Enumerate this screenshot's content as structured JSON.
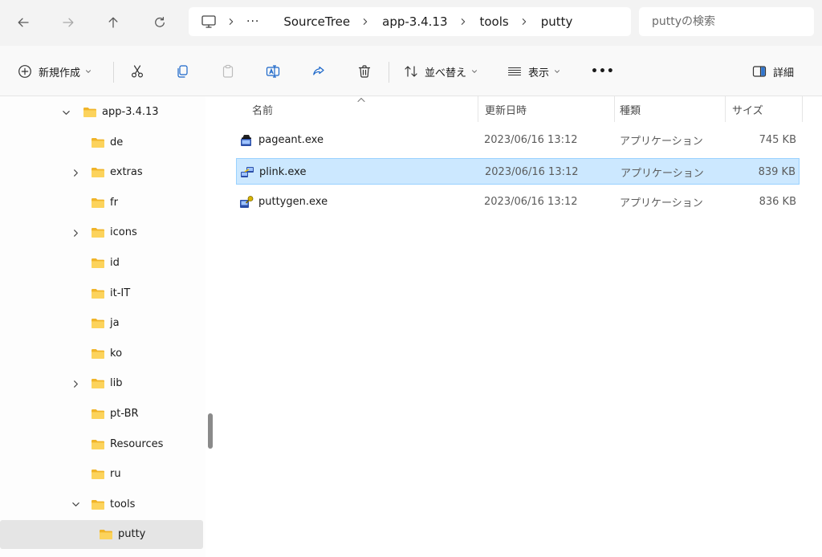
{
  "search": {
    "placeholder": "puttyの検索"
  },
  "breadcrumb": {
    "more": "···",
    "crumbs": [
      "SourceTree",
      "app-3.4.13",
      "tools",
      "putty"
    ]
  },
  "commands": {
    "new": "新規作成",
    "sort": "並べ替え",
    "view": "表示",
    "more": "•••",
    "details": "詳細"
  },
  "tree": {
    "items": [
      {
        "label": "app-3.4.13",
        "expander": "expanded"
      },
      {
        "label": "de",
        "expander": "none"
      },
      {
        "label": "extras",
        "expander": "collapsed"
      },
      {
        "label": "fr",
        "expander": "none"
      },
      {
        "label": "icons",
        "expander": "collapsed"
      },
      {
        "label": "id",
        "expander": "none"
      },
      {
        "label": "it-IT",
        "expander": "none"
      },
      {
        "label": "ja",
        "expander": "none"
      },
      {
        "label": "ko",
        "expander": "none"
      },
      {
        "label": "lib",
        "expander": "collapsed"
      },
      {
        "label": "pt-BR",
        "expander": "none"
      },
      {
        "label": "Resources",
        "expander": "none"
      },
      {
        "label": "ru",
        "expander": "none"
      },
      {
        "label": "tools",
        "expander": "expanded"
      },
      {
        "label": "putty",
        "expander": "none",
        "selected": true
      }
    ]
  },
  "columns": {
    "name": "名前",
    "date": "更新日時",
    "type": "種類",
    "size": "サイズ"
  },
  "files": [
    {
      "name": "pageant.exe",
      "date": "2023/06/16 13:12",
      "type": "アプリケーション",
      "size": "745 KB",
      "icon": "pageant-icon"
    },
    {
      "name": "plink.exe",
      "date": "2023/06/16 13:12",
      "type": "アプリケーション",
      "size": "839 KB",
      "icon": "plink-icon",
      "selected": true
    },
    {
      "name": "puttygen.exe",
      "date": "2023/06/16 13:12",
      "type": "アプリケーション",
      "size": "836 KB",
      "icon": "puttygen-icon"
    }
  ],
  "colors": {
    "selection": "#cce8ff",
    "selection_border": "#99d1ff",
    "folder": "#f5c518",
    "nav_selected": "#e5e5e5"
  }
}
